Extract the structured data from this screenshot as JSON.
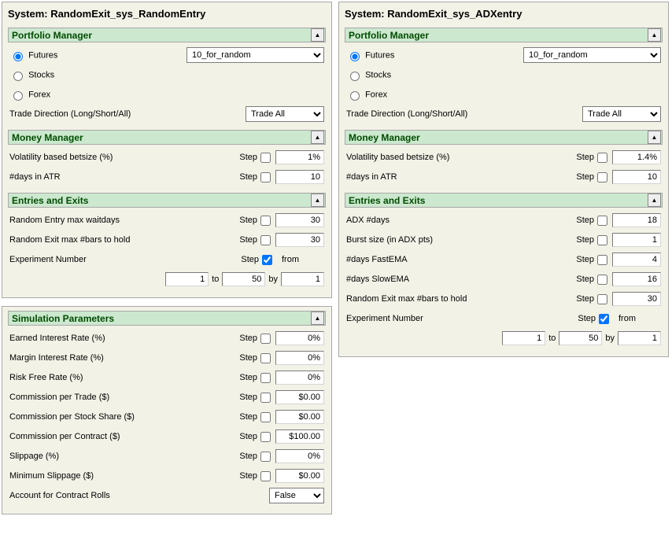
{
  "common": {
    "step_label": "Step",
    "from_label": "from",
    "to_label": "to",
    "by_label": "by",
    "collapse_glyph": "▲"
  },
  "panelA": {
    "title": "System: RandomExit_sys_RandomEntry",
    "portfolio": {
      "header": "Portfolio Manager",
      "futures": "Futures",
      "stocks": "Stocks",
      "forex": "Forex",
      "trade_dir_label": "Trade Direction (Long/Short/All)",
      "portfolio_select": "10_for_random",
      "trade_select": "Trade All"
    },
    "money": {
      "header": "Money Manager",
      "vol_label": "Volatility based betsize (%)",
      "vol_value": "1%",
      "atr_label": "#days in ATR",
      "atr_value": "10"
    },
    "entries": {
      "header": "Entries and Exits",
      "rand_entry_label": "Random Entry max waitdays",
      "rand_entry_value": "30",
      "rand_exit_label": "Random Exit max #bars to hold",
      "rand_exit_value": "30",
      "exp_label": "Experiment Number",
      "exp_from": "1",
      "exp_to": "50",
      "exp_by": "1"
    }
  },
  "panelB": {
    "title": "System: RandomExit_sys_ADXentry",
    "portfolio": {
      "header": "Portfolio Manager",
      "futures": "Futures",
      "stocks": "Stocks",
      "forex": "Forex",
      "trade_dir_label": "Trade Direction (Long/Short/All)",
      "portfolio_select": "10_for_random",
      "trade_select": "Trade All"
    },
    "money": {
      "header": "Money Manager",
      "vol_label": "Volatility based betsize (%)",
      "vol_value": "1.4%",
      "atr_label": "#days in ATR",
      "atr_value": "10"
    },
    "entries": {
      "header": "Entries and Exits",
      "adx_label": "ADX #days",
      "adx_value": "18",
      "burst_label": "Burst size (in ADX pts)",
      "burst_value": "1",
      "fastema_label": "#days FastEMA",
      "fastema_value": "4",
      "slowema_label": "#days SlowEMA",
      "slowema_value": "16",
      "rand_exit_label": "Random Exit max #bars to hold",
      "rand_exit_value": "30",
      "exp_label": "Experiment Number",
      "exp_from": "1",
      "exp_to": "50",
      "exp_by": "1"
    }
  },
  "panelC": {
    "title": "",
    "header": "Simulation Parameters",
    "rows": {
      "earned_label": "Earned Interest Rate (%)",
      "earned_value": "0%",
      "margin_label": "Margin Interest Rate (%)",
      "margin_value": "0%",
      "riskfree_label": "Risk Free Rate (%)",
      "riskfree_value": "0%",
      "comm_trade_label": "Commission per Trade ($)",
      "comm_trade_value": "$0.00",
      "comm_stock_label": "Commission per Stock Share ($)",
      "comm_stock_value": "$0.00",
      "comm_contract_label": "Commission per Contract ($)",
      "comm_contract_value": "$100.00",
      "slippage_label": "Slippage (%)",
      "slippage_value": "0%",
      "min_slippage_label": "Minimum Slippage ($)",
      "min_slippage_value": "$0.00",
      "rolls_label": "Account for Contract Rolls",
      "rolls_value": "False"
    }
  }
}
